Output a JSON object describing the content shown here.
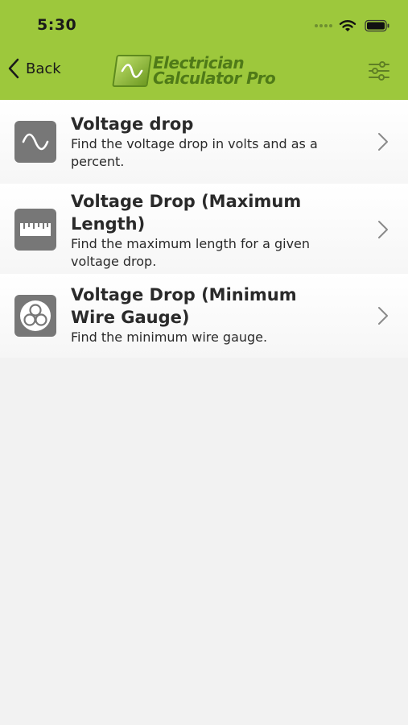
{
  "status_bar": {
    "time": "5:30"
  },
  "nav": {
    "back_label": "Back",
    "logo_line1": "Electrician",
    "logo_line2": "Calculator Pro"
  },
  "colors": {
    "header_green": "#9dc83c",
    "icon_gray": "#777777",
    "background": "#f2f2f2"
  },
  "items": [
    {
      "title": "Voltage drop",
      "description": "Find the voltage drop in volts and as a percent.",
      "icon": "sine-wave-icon"
    },
    {
      "title": "Voltage Drop (Maximum Length)",
      "description": "Find the maximum length for a given voltage drop.",
      "icon": "ruler-icon"
    },
    {
      "title": "Voltage Drop (Minimum Wire Gauge)",
      "description": "Find the minimum wire gauge.",
      "icon": "wire-gauge-icon"
    }
  ]
}
